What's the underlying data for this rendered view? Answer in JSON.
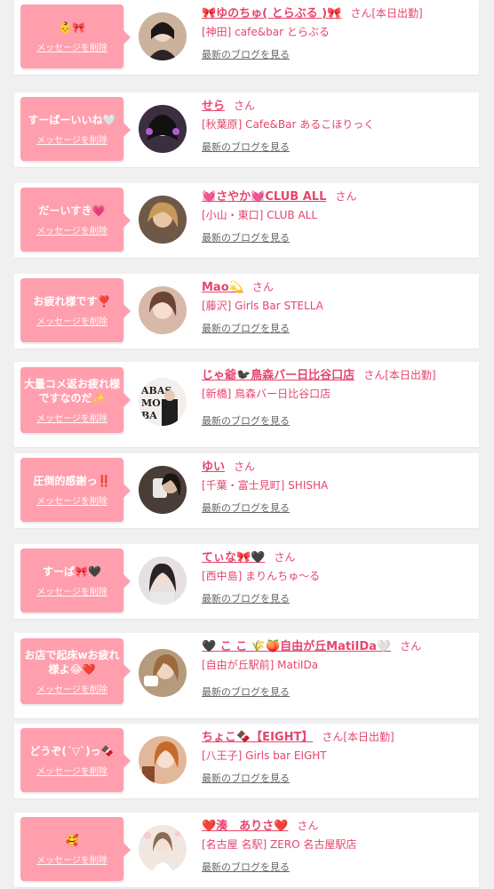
{
  "message_link": "メッセージを削除",
  "blog_link": "最新のブログを見る",
  "san": "さん",
  "cards": [
    {
      "message": "👶🎀",
      "name": "🎀ゆのちゅ( とらぶる )🎀",
      "status": "[本日出勤]",
      "shop": "[神田] cafe&bar とらぶる",
      "avatar_color": "#8a6a5e"
    },
    {
      "message": "すーばーいいね🤍",
      "name": "せら",
      "status": "",
      "shop": "[秋葉原] Cafe&Bar あるこほりっく",
      "avatar_color": "#5b4a63"
    },
    {
      "message": "だーいすき💗",
      "name": "💓さやか💓CLUB ALL",
      "status": "",
      "shop": "[小山・東口] CLUB ALL",
      "avatar_color": "#9a7452"
    },
    {
      "message": "お疲れ様です❣️",
      "name": "Mao💫",
      "status": "",
      "shop": "[藤沢] Girls Bar STELLA",
      "avatar_color": "#b08070"
    },
    {
      "message": "大量コメ返お疲れ様ですなのだ✨",
      "name": "じゃ爺🐦‍⬛鳥森バー日比谷口店",
      "status": "[本日出勤]",
      "shop": "[新橋] 鳥森バー日比谷口店",
      "avatar_color": "#e8e4e0"
    },
    {
      "message": "圧倒的感謝っ‼️",
      "name": "ゆい",
      "status": "",
      "shop": "[千葉・富士見町] SHISHA",
      "avatar_color": "#3a302c"
    },
    {
      "message": "すーぱ🎀🖤",
      "name": "てぃな🎀🖤",
      "status": "",
      "shop": "[西中島] まりんちゅ～る",
      "avatar_color": "#c7b8c0"
    },
    {
      "message": "お店で起床wお疲れ様よ😂❤️",
      "name": "🖤 こ こ 🌾🍑自由が丘MatiIDa🤍",
      "status": "",
      "shop": "[自由が丘駅前] MatiIDa",
      "avatar_color": "#a88a6a"
    },
    {
      "message": "どうぞ(´▽`)っ🍫",
      "name": "ちょこ🍫【EIGHT】",
      "status": "[本日出勤]",
      "shop": "[八王子] Girls bar EIGHT",
      "avatar_color": "#c98f70"
    },
    {
      "message": "🥰",
      "name": "❤️湊　ありさ❤️",
      "status": "",
      "shop": "[名古屋 名駅] ZERO 名古屋駅店",
      "avatar_color": "#d9cfc6"
    }
  ]
}
